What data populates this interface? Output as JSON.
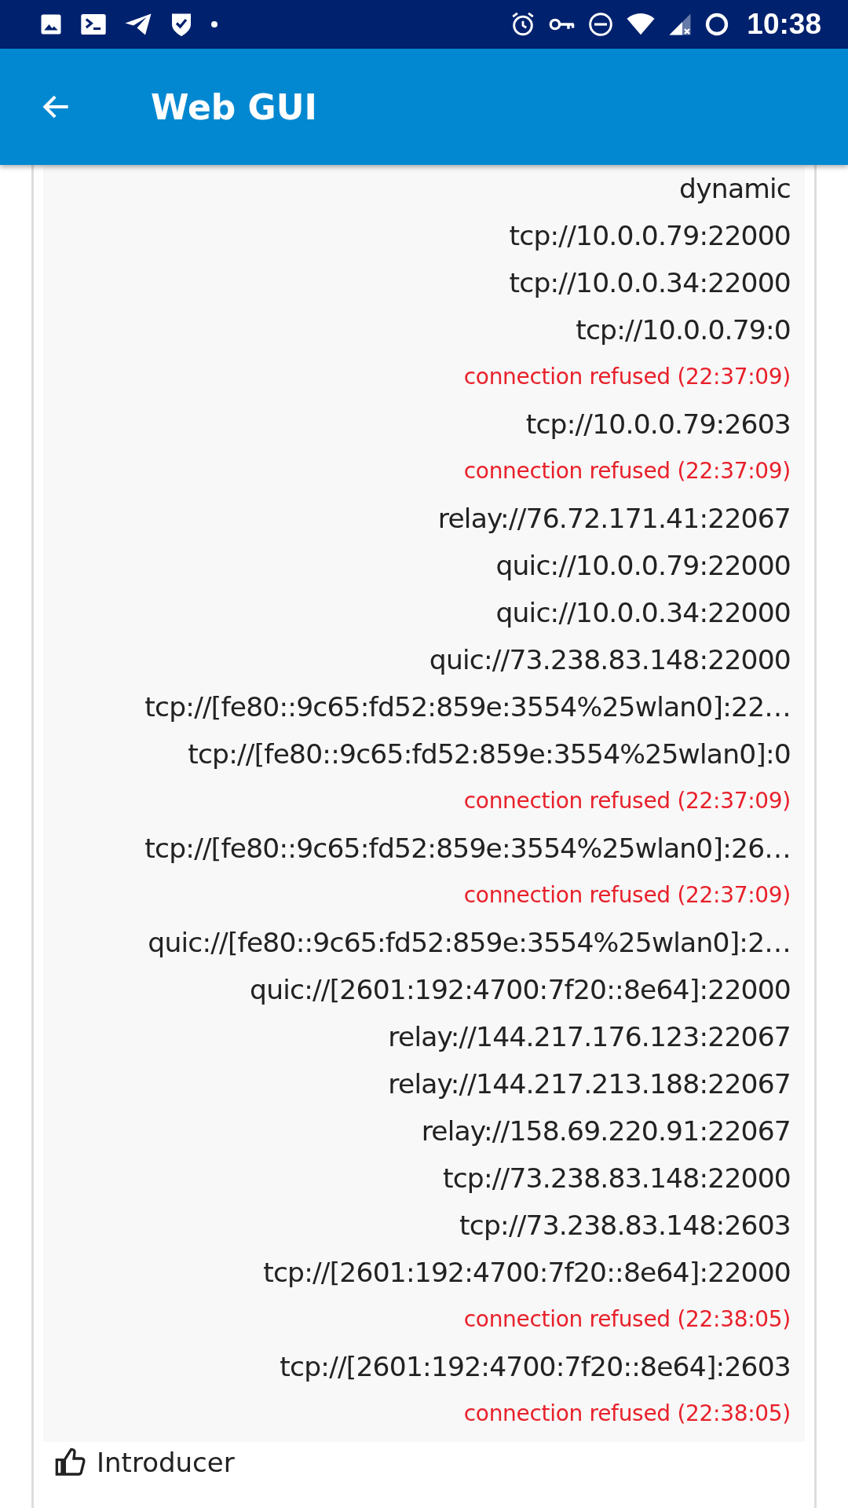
{
  "status_bar": {
    "time": "10:38"
  },
  "app_bar": {
    "title": "Web GUI"
  },
  "addresses": [
    {
      "kind": "address",
      "text": "dynamic"
    },
    {
      "kind": "address",
      "text": "tcp://10.0.0.79:22000"
    },
    {
      "kind": "address",
      "text": "tcp://10.0.0.34:22000"
    },
    {
      "kind": "address",
      "text": "tcp://10.0.0.79:0"
    },
    {
      "kind": "error",
      "text": "connection refused (22:37:09)"
    },
    {
      "kind": "address",
      "text": "tcp://10.0.0.79:2603"
    },
    {
      "kind": "error",
      "text": "connection refused (22:37:09)"
    },
    {
      "kind": "address",
      "text": "relay://76.72.171.41:22067"
    },
    {
      "kind": "address",
      "text": "quic://10.0.0.79:22000"
    },
    {
      "kind": "address",
      "text": "quic://10.0.0.34:22000"
    },
    {
      "kind": "address",
      "text": "quic://73.238.83.148:22000"
    },
    {
      "kind": "address",
      "text": "tcp://[fe80::9c65:fd52:859e:3554%25wlan0]:22…"
    },
    {
      "kind": "address",
      "text": "tcp://[fe80::9c65:fd52:859e:3554%25wlan0]:0"
    },
    {
      "kind": "error",
      "text": "connection refused (22:37:09)"
    },
    {
      "kind": "address",
      "text": "tcp://[fe80::9c65:fd52:859e:3554%25wlan0]:26…"
    },
    {
      "kind": "error",
      "text": "connection refused (22:37:09)"
    },
    {
      "kind": "address",
      "text": "quic://[fe80::9c65:fd52:859e:3554%25wlan0]:2…"
    },
    {
      "kind": "address",
      "text": "quic://[2601:192:4700:7f20::8e64]:22000"
    },
    {
      "kind": "address",
      "text": "relay://144.217.176.123:22067"
    },
    {
      "kind": "address",
      "text": "relay://144.217.213.188:22067"
    },
    {
      "kind": "address",
      "text": "relay://158.69.220.91:22067"
    },
    {
      "kind": "address",
      "text": "tcp://73.238.83.148:22000"
    },
    {
      "kind": "address",
      "text": "tcp://73.238.83.148:2603"
    },
    {
      "kind": "address",
      "text": "tcp://[2601:192:4700:7f20::8e64]:22000"
    },
    {
      "kind": "error",
      "text": "connection refused (22:38:05)"
    },
    {
      "kind": "address",
      "text": "tcp://[2601:192:4700:7f20::8e64]:2603"
    },
    {
      "kind": "error",
      "text": "connection refused (22:38:05)"
    }
  ],
  "next_row": {
    "label": "Introducer"
  }
}
